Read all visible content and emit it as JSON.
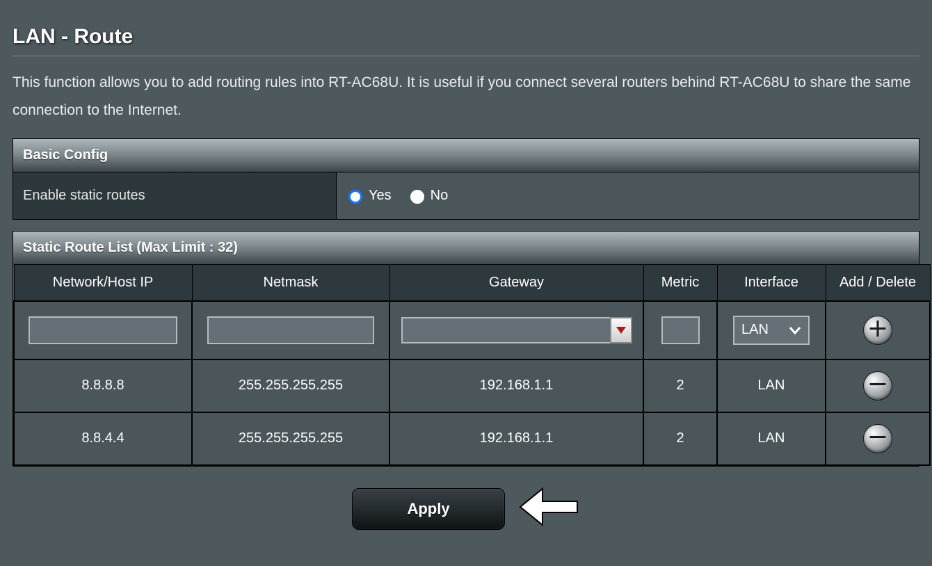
{
  "page": {
    "title": "LAN - Route",
    "description": "This function allows you to add routing rules into RT-AC68U. It is useful if you connect several routers behind RT-AC68U to share the same connection to the Internet."
  },
  "basic_config": {
    "header": "Basic Config",
    "enable_label": "Enable static routes",
    "yes_label": "Yes",
    "no_label": "No",
    "selected": "yes"
  },
  "route_list": {
    "header": "Static Route List (Max Limit : 32)",
    "columns": {
      "ip": "Network/Host IP",
      "netmask": "Netmask",
      "gateway": "Gateway",
      "metric": "Metric",
      "interface": "Interface",
      "action": "Add / Delete"
    },
    "input_row": {
      "ip": "",
      "netmask": "",
      "gateway": "",
      "metric": "",
      "interface_selected": "LAN"
    },
    "rows": [
      {
        "ip": "8.8.8.8",
        "netmask": "255.255.255.255",
        "gateway": "192.168.1.1",
        "metric": "2",
        "interface": "LAN"
      },
      {
        "ip": "8.8.4.4",
        "netmask": "255.255.255.255",
        "gateway": "192.168.1.1",
        "metric": "2",
        "interface": "LAN"
      }
    ]
  },
  "apply_label": "Apply"
}
